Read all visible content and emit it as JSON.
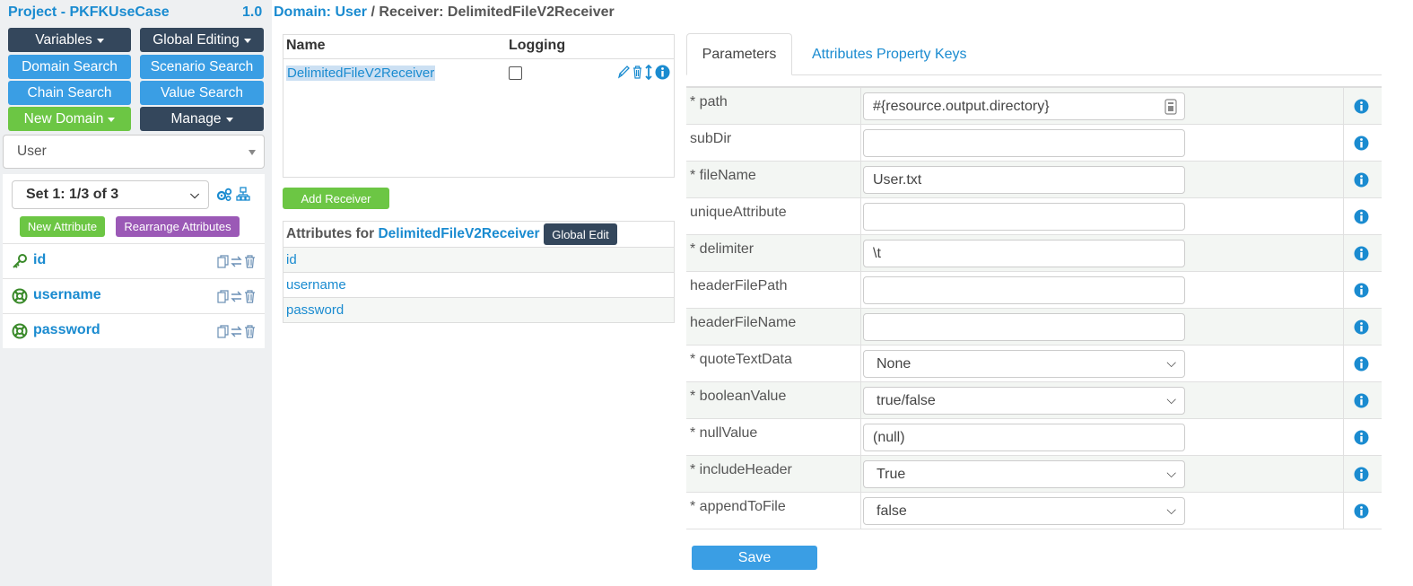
{
  "sidebar": {
    "project_title": "Project - PKFKUseCase",
    "version": "1.0",
    "buttons": {
      "variables": "Variables",
      "global_editing": "Global Editing",
      "domain_search": "Domain Search",
      "scenario_search": "Scenario Search",
      "chain_search": "Chain Search",
      "value_search": "Value Search",
      "new_domain": "New Domain",
      "manage": "Manage"
    },
    "domain_select": "User",
    "set_select": "Set 1: 1/3 of 3",
    "new_attribute": "New Attribute",
    "rearrange_attributes": "Rearrange Attributes",
    "attributes": [
      {
        "name": "id",
        "icon": "key-icon"
      },
      {
        "name": "username",
        "icon": "lifebuoy-icon"
      },
      {
        "name": "password",
        "icon": "lifebuoy-icon"
      }
    ]
  },
  "header": {
    "domain_link": "Domain: User",
    "separator": "/",
    "current": "Receiver: DelimitedFileV2Receiver"
  },
  "receivers": {
    "col_name": "Name",
    "col_logging": "Logging",
    "rows": [
      {
        "name": "DelimitedFileV2Receiver",
        "logging": false
      }
    ],
    "add_button": "Add Receiver"
  },
  "attributes_for": {
    "prefix": "Attributes for",
    "receiver": "DelimitedFileV2Receiver",
    "global_edit": "Global Edit",
    "rows": [
      "id",
      "username",
      "password"
    ]
  },
  "tabs": {
    "parameters": "Parameters",
    "property_keys": "Attributes Property Keys"
  },
  "params": [
    {
      "label": "* path",
      "value": "#{resource.output.directory}",
      "type": "text"
    },
    {
      "label": "subDir",
      "value": "",
      "type": "text"
    },
    {
      "label": "* fileName",
      "value": "User.txt",
      "type": "text"
    },
    {
      "label": "uniqueAttribute",
      "value": "",
      "type": "text"
    },
    {
      "label": "* delimiter",
      "value": "\\t",
      "type": "text"
    },
    {
      "label": "headerFilePath",
      "value": "",
      "type": "text"
    },
    {
      "label": "headerFileName",
      "value": "",
      "type": "text"
    },
    {
      "label": "* quoteTextData",
      "value": "None",
      "type": "select"
    },
    {
      "label": "* booleanValue",
      "value": "true/false",
      "type": "select"
    },
    {
      "label": "* nullValue",
      "value": "(null)",
      "type": "text"
    },
    {
      "label": "* includeHeader",
      "value": "True",
      "type": "select"
    },
    {
      "label": "* appendToFile",
      "value": "false",
      "type": "select"
    }
  ],
  "save_label": "Save",
  "colors": {
    "link": "#1a8bd0",
    "dark": "#34475c",
    "blue": "#3a9ee4",
    "green": "#6cc644",
    "purple": "#9b59b6"
  }
}
